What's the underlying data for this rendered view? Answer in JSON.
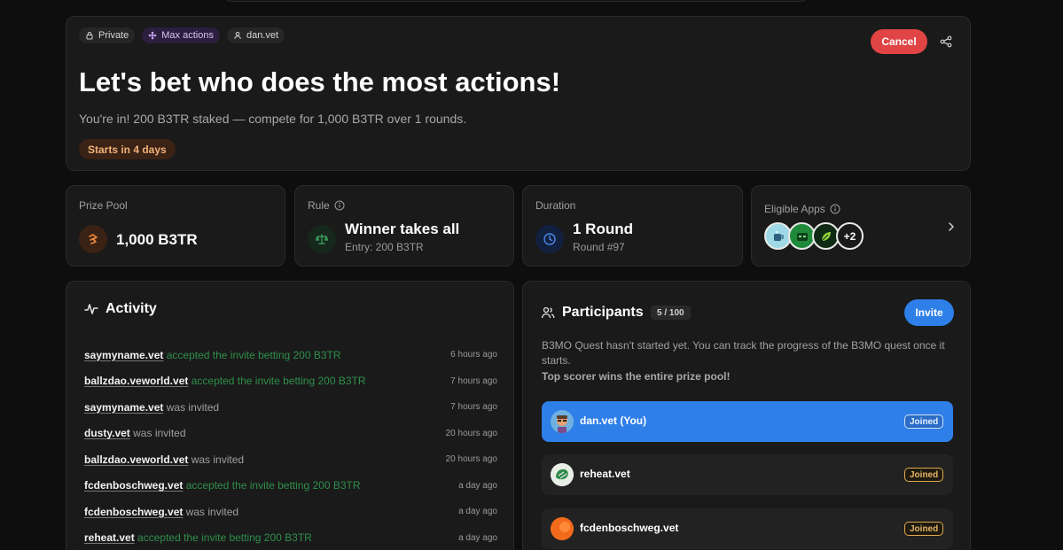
{
  "hero": {
    "chips": {
      "private": "Private",
      "max_actions": "Max actions",
      "creator": "dan.vet"
    },
    "cancel_label": "Cancel",
    "title": "Let's bet who does the most actions!",
    "subtitle": "You're in! 200 B3TR staked — compete for 1,000 B3TR over 1 rounds.",
    "starts_badge": "Starts in 4 days"
  },
  "stats": {
    "prize_pool": {
      "label": "Prize Pool",
      "value": "1,000 B3TR"
    },
    "rule": {
      "label": "Rule",
      "value": "Winner takes all",
      "sub": "Entry: 200 B3TR"
    },
    "duration": {
      "label": "Duration",
      "value": "1 Round",
      "sub": "Round #97"
    },
    "eligible_apps": {
      "label": "Eligible Apps",
      "more": "+2"
    }
  },
  "activity": {
    "title": "Activity",
    "items": [
      {
        "user": "saymyname.vet",
        "action": "accepted the invite betting 200 B3TR",
        "time": "6 hours ago"
      },
      {
        "user": "ballzdao.veworld.vet",
        "action": "accepted the invite betting 200 B3TR",
        "time": "7 hours ago"
      },
      {
        "user": "saymyname.vet",
        "action": "was invited",
        "time": "7 hours ago"
      },
      {
        "user": "dusty.vet",
        "action": "was invited",
        "time": "20 hours ago"
      },
      {
        "user": "ballzdao.veworld.vet",
        "action": "was invited",
        "time": "20 hours ago"
      },
      {
        "user": "fcdenboschweg.vet",
        "action": "accepted the invite betting 200 B3TR",
        "time": "a day ago"
      },
      {
        "user": "fcdenboschweg.vet",
        "action": "was invited",
        "time": "a day ago"
      },
      {
        "user": "reheat.vet",
        "action": "accepted the invite betting 200 B3TR",
        "time": "a day ago"
      }
    ]
  },
  "participants": {
    "title": "Participants",
    "count": "5 / 100",
    "invite_label": "Invite",
    "description": "B3MO Quest hasn't started yet. You can track the progress of the B3MO quest once it starts.",
    "strong_note": "Top scorer wins the entire prize pool!",
    "list": [
      {
        "name": "dan.vet (You)",
        "status": "Joined"
      },
      {
        "name": "reheat.vet",
        "status": "Joined"
      },
      {
        "name": "fcdenboschweg.vet",
        "status": "Joined"
      }
    ]
  },
  "colors": {
    "accent_blue": "#2f7fe8",
    "cancel_red": "#e04444",
    "success_green": "#2f8f4a",
    "badge_orange": "#f2b07a"
  }
}
